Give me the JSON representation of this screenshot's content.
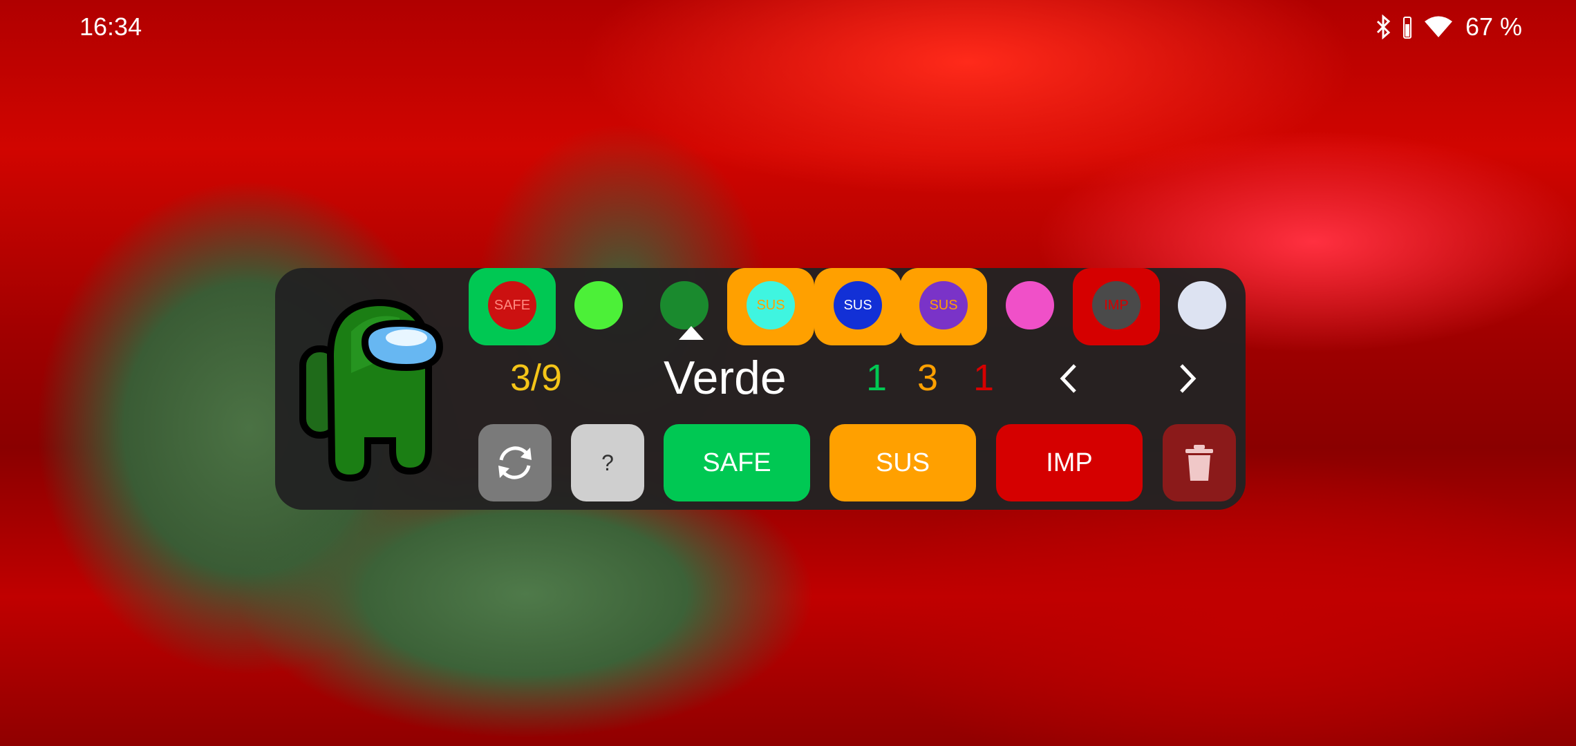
{
  "status_bar": {
    "time": "16:34",
    "battery": "67 %",
    "icons": [
      "bluetooth-icon",
      "battery-vertical-icon",
      "wifi-icon"
    ]
  },
  "colors": {
    "safe": "#00c853",
    "sus": "#ffa000",
    "imp": "#d50000",
    "panel": "#222222",
    "counter": "#f5c518"
  },
  "players": [
    {
      "color": "#cc1111",
      "tag": "safe",
      "tag_label": "SAFE",
      "label_color": "#ff8a80"
    },
    {
      "color": "#4cf038",
      "tag": "",
      "tag_label": ""
    },
    {
      "color": "#1a8a2e",
      "tag": "",
      "tag_label": "",
      "selected": true
    },
    {
      "color": "#3ff5e0",
      "tag": "sus",
      "tag_label": "SUS",
      "label_color": "#ffa000"
    },
    {
      "color": "#1230d6",
      "tag": "sus",
      "tag_label": "SUS",
      "label_color": "#ffffff"
    },
    {
      "color": "#7a33c8",
      "tag": "sus",
      "tag_label": "SUS",
      "label_color": "#ffa000"
    },
    {
      "color": "#f050c8",
      "tag": "",
      "tag_label": ""
    },
    {
      "color": "#4a4a4a",
      "tag": "imp",
      "tag_label": "IMP",
      "label_color": "#d50000"
    },
    {
      "color": "#dde3f2",
      "tag": "",
      "tag_label": ""
    }
  ],
  "selected_player": {
    "name": "Verde",
    "counter": "3/9"
  },
  "counts": {
    "safe": "1",
    "sus": "3",
    "imp": "1"
  },
  "buttons": {
    "reset_icon": "refresh-icon",
    "unknown_label": "?",
    "safe_label": "SAFE",
    "sus_label": "SUS",
    "imp_label": "IMP",
    "delete_icon": "trash-icon"
  }
}
